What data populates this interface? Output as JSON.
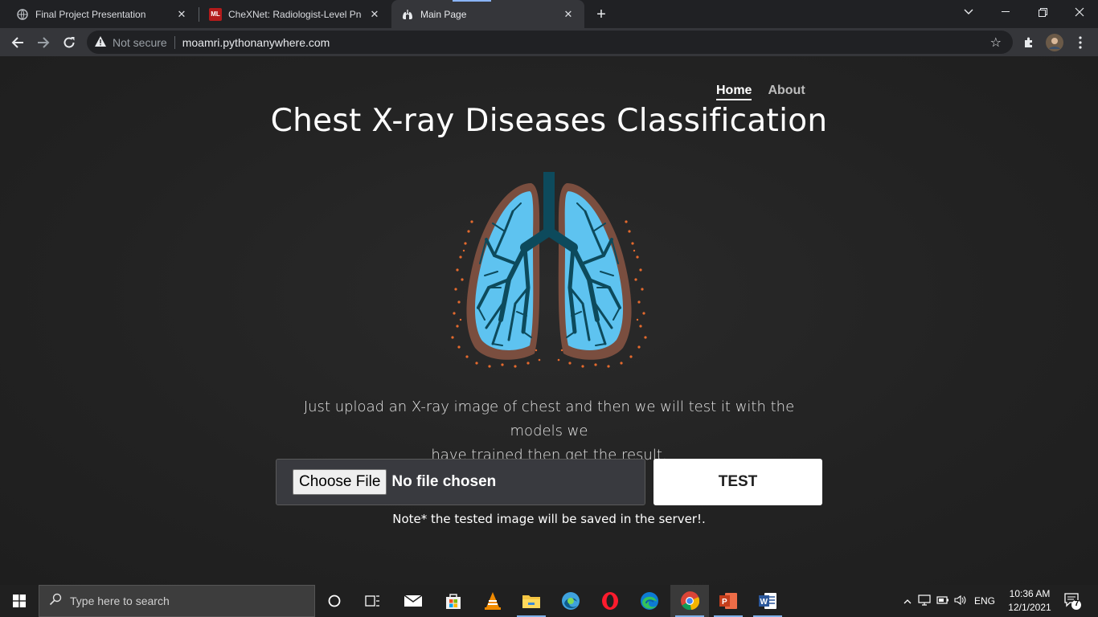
{
  "browser": {
    "tabs": [
      {
        "title": "Final Project Presentation",
        "icon": "globe-icon",
        "active": false
      },
      {
        "title": "CheXNet: Radiologist-Level Pneu",
        "icon": "ml-logo-icon",
        "favicon_text": "ML",
        "active": false
      },
      {
        "title": "Main Page",
        "icon": "lungs-icon",
        "active": true
      }
    ],
    "security_label": "Not secure",
    "url": "moamri.pythonanywhere.com"
  },
  "nav": {
    "home": "Home",
    "about": "About"
  },
  "page": {
    "title": "Chest X-ray Diseases Classification",
    "description_line1": "Just upload an X-ray image of chest and then we will test it with the models we",
    "description_line2": "have trained then get the result.",
    "choose_file": "Choose File",
    "no_file": "No file chosen",
    "test_button": "TEST",
    "note": "Note* the tested image will be saved in the server!."
  },
  "colors": {
    "lung_fill": "#5ec3f0",
    "lung_outline": "#7a4e3f",
    "bronchi": "#0d4a5c",
    "dots": "#e56a2e"
  },
  "taskbar": {
    "search_placeholder": "Type here to search",
    "language": "ENG",
    "time": "10:36 AM",
    "date": "12/1/2021",
    "notification_count": "7",
    "apps": [
      "cortana-icon",
      "task-view-icon",
      "mail-icon",
      "store-icon",
      "vlc-icon",
      "file-explorer-icon",
      "edge-dev-icon",
      "opera-icon",
      "edge-icon",
      "chrome-icon",
      "powerpoint-icon",
      "word-icon"
    ]
  }
}
